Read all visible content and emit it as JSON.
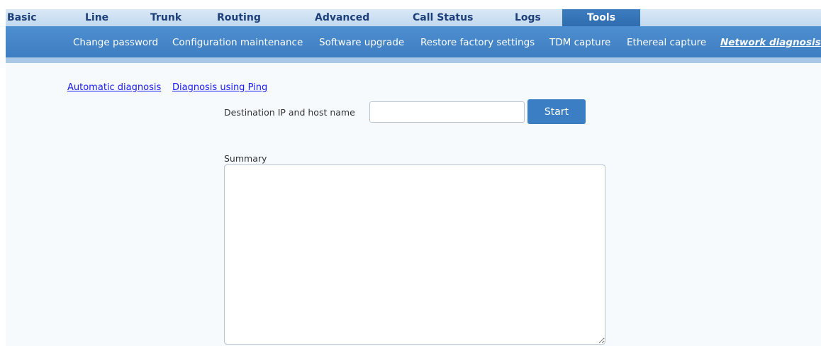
{
  "top_nav": {
    "tabs": [
      {
        "label": "Basic",
        "active": false
      },
      {
        "label": "Line",
        "active": false
      },
      {
        "label": "Trunk",
        "active": false
      },
      {
        "label": "Routing",
        "active": false
      },
      {
        "label": "Advanced",
        "active": false
      },
      {
        "label": "Call Status",
        "active": false
      },
      {
        "label": "Logs",
        "active": false
      },
      {
        "label": "Tools",
        "active": true
      }
    ]
  },
  "sub_nav": {
    "items": [
      {
        "label": "Change password",
        "active": false
      },
      {
        "label": "Configuration maintenance",
        "active": false
      },
      {
        "label": "Software upgrade",
        "active": false
      },
      {
        "label": "Restore factory settings",
        "active": false
      },
      {
        "label": "TDM capture",
        "active": false
      },
      {
        "label": "Ethereal capture",
        "active": false
      },
      {
        "label": "Network diagnosis",
        "active": true
      }
    ]
  },
  "diagnosis_links": {
    "automatic": "Automatic diagnosis",
    "ping": "Diagnosis using Ping"
  },
  "form": {
    "destination_label": "Destination IP and host name",
    "destination_value": "",
    "start_label": "Start",
    "summary_label": "Summary",
    "summary_value": ""
  },
  "colors": {
    "top_nav_bg": "#c2d9ef",
    "top_nav_text": "#1d3f7a",
    "active_tab_bg": "#2f6cb0",
    "sub_nav_bg": "#3d7dc1",
    "band": "#a9c7e6",
    "link": "#1a1aff",
    "button": "#3c7ec3"
  }
}
